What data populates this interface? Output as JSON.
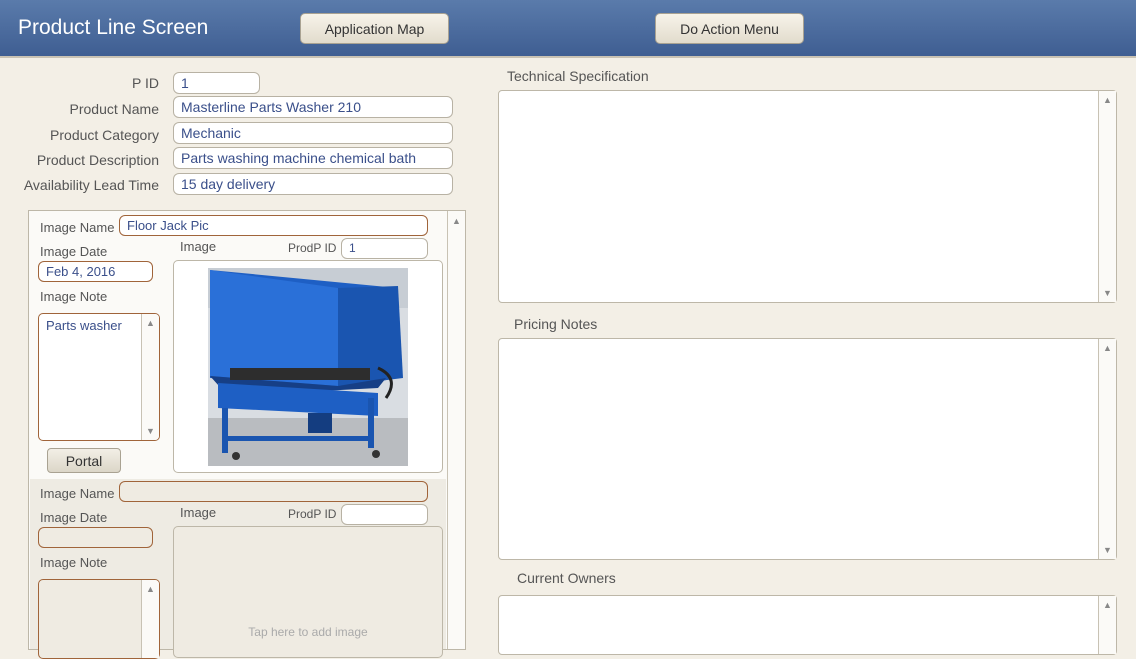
{
  "header": {
    "title": "Product Line Screen",
    "app_map_label": "Application Map",
    "action_menu_label": "Do Action Menu"
  },
  "product": {
    "pid_label": "P ID",
    "pid_value": "1",
    "name_label": "Product Name",
    "name_value": "Masterline Parts Washer 210",
    "category_label": "Product Category",
    "category_value": "Mechanic",
    "description_label": "Product Description",
    "description_value": "Parts washing machine chemical bath",
    "lead_time_label": "Availability Lead Time",
    "lead_time_value": "15 day delivery"
  },
  "portal": {
    "rows": [
      {
        "image_name_label": "Image Name",
        "image_name_value": "Floor Jack Pic",
        "image_date_label": "Image Date",
        "image_date_value": "Feb 4, 2016",
        "image_note_label": "Image Note",
        "image_note_value": "Parts washer",
        "image_label": "Image",
        "prodp_id_label": "ProdP ID",
        "prodp_id_value": "1",
        "portal_button_label": "Portal"
      },
      {
        "image_name_label": "Image Name",
        "image_name_value": "",
        "image_date_label": "Image Date",
        "image_date_value": "",
        "image_note_label": "Image Note",
        "image_note_value": "",
        "image_label": "Image",
        "prodp_id_label": "ProdP ID",
        "prodp_id_value": "",
        "add_image_placeholder": "Tap here to add image"
      }
    ]
  },
  "right": {
    "tech_spec_label": "Technical Specification",
    "pricing_notes_label": "Pricing Notes",
    "current_owners_label": "Current Owners"
  },
  "colors": {
    "header_bg": "#4a6ba0",
    "field_text": "#3a4f8a",
    "portal_field_border": "#a0643a",
    "page_bg": "#f3efe6"
  }
}
